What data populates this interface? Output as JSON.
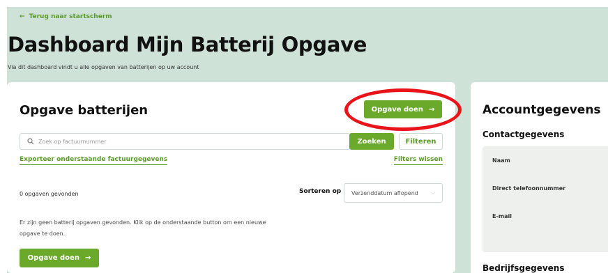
{
  "header": {
    "back_link": "Terug naar startscherm",
    "title": "Dashboard Mijn Batterij Opgave",
    "subtitle": "Via dit dashboard vindt u alle opgaven van batterijen op uw account"
  },
  "main": {
    "title": "Opgave batterijen",
    "new_button": "Opgave doen",
    "search": {
      "placeholder": "Zoek op factuurnummer",
      "button": "Zoeken"
    },
    "filter_button": "Filteren",
    "export_link": "Exporteer onderstaande factuurgegevens",
    "clear_filters_link": "Filters wissen",
    "results_count": "0 opgaven gevonden",
    "sort": {
      "label": "Sorteren op",
      "selected": "Verzenddatum aflopend"
    },
    "empty_message": "Er zijn geen batterij opgaven gevonden. Klik op de onderstaande button om een nieuwe opgave te doen.",
    "new_button_bottom": "Opgave doen"
  },
  "account": {
    "title": "Accountgegevens",
    "contact_heading": "Contactgegevens",
    "fields": [
      "Naam",
      "Direct telefoonnummer",
      "E-mail"
    ],
    "company_heading": "Bedrijfsgegevens"
  },
  "colors": {
    "accent": "#6ba92a",
    "highlight_ring": "#e8141a",
    "background": "#cfe2d8"
  },
  "icons": {
    "back": "arrow-left-icon",
    "search": "search-icon",
    "arrow": "arrow-right-icon",
    "chevron": "chevron-down-icon"
  }
}
